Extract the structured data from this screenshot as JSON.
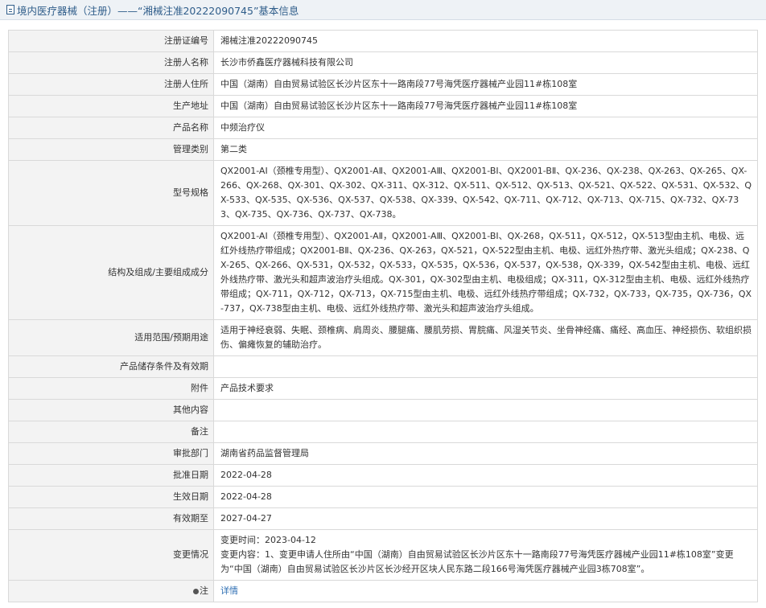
{
  "header": {
    "title": "境内医疗器械（注册）——“湘械注准20222090745”基本信息"
  },
  "rows": {
    "reg_no": {
      "label": "注册证编号",
      "value": "湘械注准20222090745"
    },
    "registrant": {
      "label": "注册人名称",
      "value": "长沙市侨鑫医疗器械科技有限公司"
    },
    "registrant_addr": {
      "label": "注册人住所",
      "value": "中国（湖南）自由贸易试验区长沙片区东十一路南段77号海凭医疗器械产业园11#栋108室"
    },
    "production_addr": {
      "label": "生产地址",
      "value": "中国（湖南）自由贸易试验区长沙片区东十一路南段77号海凭医疗器械产业园11#栋108室"
    },
    "product_name": {
      "label": "产品名称",
      "value": "中频治疗仪"
    },
    "mgmt_class": {
      "label": "管理类别",
      "value": "第二类"
    },
    "model_spec": {
      "label": "型号规格",
      "value": "QX2001-AI（颈椎专用型）、QX2001-AⅡ、QX2001-AⅢ、QX2001-BI、QX2001-BⅡ、QX-236、QX-238、QX-263、QX-265、QX-266、QX-268、QX-301、QX-302、QX-311、QX-312、QX-511、QX-512、QX-513、QX-521、QX-522、QX-531、QX-532、QX-533、QX-535、QX-536、QX-537、QX-538、QX-339、QX-542、QX-711、QX-712、QX-713、QX-715、QX-732、QX-733、QX-735、QX-736、QX-737、QX-738。"
    },
    "structure": {
      "label": "结构及组成/主要组成成分",
      "value": "QX2001-AI（颈椎专用型）、QX2001-AⅡ，QX2001-AⅢ、QX2001-BI、QX-268，QX-511，QX-512，QX-513型由主机、电极、远红外线热疗带组成；QX2001-BⅡ、QX-236、QX-263，QX-521，QX-522型由主机、电极、远红外热疗带、激光头组成；QX-238、QX-265、QX-266、QX-531，QX-532，QX-533，QX-535，QX-536，QX-537，QX-538，QX-339，QX-542型由主机、电极、远红外线热疗带、激光头和超声波治疗头组成。QX-301，QX-302型由主机、电极组成；QX-311，QX-312型由主机、电极、远红外线热疗带组成；QX-711，QX-712，QX-713，QX-715型由主机、电极、远红外线热疗带组成；QX-732，QX-733，QX-735，QX-736，QX-737，QX-738型由主机、电极、远红外线热疗带、激光头和超声波治疗头组成。"
    },
    "usage": {
      "label": "适用范围/预期用途",
      "value": "适用于神经衰弱、失眠、颈椎病、肩周炎、腰腿痛、腰肌劳损、胃脘痛、风湿关节炎、坐骨神经痛、痛经、高血压、神经损伤、软组织损伤、偏瘫恢复的辅助治疗。"
    },
    "storage": {
      "label": "产品储存条件及有效期",
      "value": ""
    },
    "attachment": {
      "label": "附件",
      "value": "产品技术要求"
    },
    "other": {
      "label": "其他内容",
      "value": ""
    },
    "remark": {
      "label": "备注",
      "value": ""
    },
    "approval_dept": {
      "label": "审批部门",
      "value": "湖南省药品监督管理局"
    },
    "approval_date": {
      "label": "批准日期",
      "value": "2022-04-28"
    },
    "effective_date": {
      "label": "生效日期",
      "value": "2022-04-28"
    },
    "valid_until": {
      "label": "有效期至",
      "value": "2027-04-27"
    },
    "changes": {
      "label": "变更情况",
      "time_line": "变更时间：2023-04-12",
      "content_line": "变更内容：1、变更申请人住所由“中国（湖南）自由贸易试验区长沙片区东十一路南段77号海凭医疗器械产业园11#栋108室”变更为“中国（湖南）自由贸易试验区长沙片区长沙经开区块人民东路二段166号海凭医疗器械产业园3栋708室”。"
    },
    "note": {
      "label": "注",
      "link": "详情"
    }
  },
  "colors": {
    "header_bg": "#eef2f6",
    "header_text": "#2f5d8a",
    "label_bg": "#f3f3f3",
    "border": "#d9d9d9",
    "link": "#2f6fb3"
  }
}
